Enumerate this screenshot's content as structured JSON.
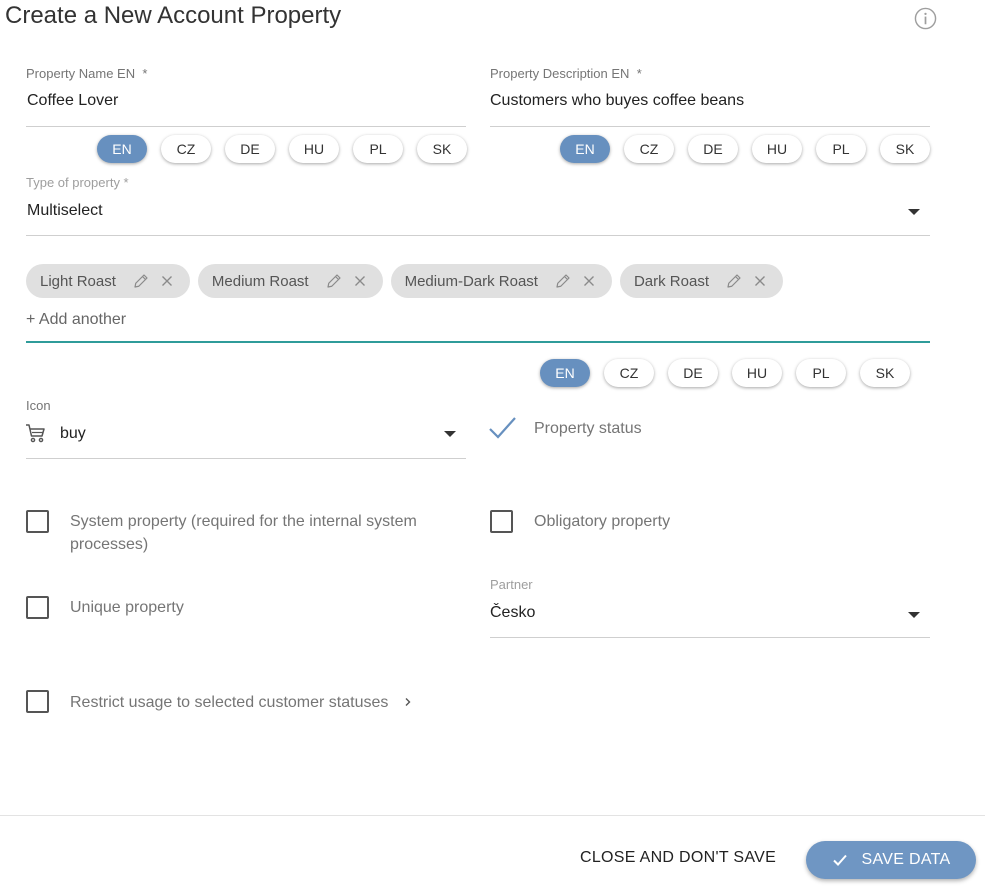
{
  "dialog": {
    "title": "Create a New Account Property"
  },
  "property_name": {
    "label": "Property Name EN",
    "required_mark": "*",
    "value": "Coffee Lover",
    "langs": [
      "EN",
      "CZ",
      "DE",
      "HU",
      "PL",
      "SK"
    ],
    "active_lang": "EN"
  },
  "property_description": {
    "label": "Property Description EN",
    "required_mark": "*",
    "value": "Customers who buyes coffee beans",
    "langs": [
      "EN",
      "CZ",
      "DE",
      "HU",
      "PL",
      "SK"
    ],
    "active_lang": "EN"
  },
  "type_of_property": {
    "label": "Type of property *",
    "value": "Multiselect"
  },
  "options": {
    "chips": [
      "Light Roast",
      "Medium Roast",
      "Medium-Dark Roast",
      "Dark Roast"
    ],
    "add_placeholder": "+ Add another",
    "langs": [
      "EN",
      "CZ",
      "DE",
      "HU",
      "PL",
      "SK"
    ],
    "active_lang": "EN"
  },
  "icon_field": {
    "label": "Icon",
    "value": "buy",
    "icon": "shopping-cart-icon"
  },
  "property_status": {
    "label": "Property status",
    "checked": true
  },
  "system_property": {
    "label": "System property (required for the internal system processes)",
    "checked": false
  },
  "obligatory_property": {
    "label": "Obligatory property",
    "checked": false
  },
  "unique_property": {
    "label": "Unique property",
    "checked": false
  },
  "partner": {
    "label": "Partner",
    "value": "Česko"
  },
  "restrict_usage": {
    "label": "Restrict usage to selected customer statuses",
    "checked": false
  },
  "footer": {
    "close_label": "CLOSE AND DON'T SAVE",
    "save_label": "SAVE DATA"
  },
  "colors": {
    "accent": "#6790bf",
    "underline_active": "#2f9c9a",
    "chip_bg": "#e0e0e0"
  }
}
